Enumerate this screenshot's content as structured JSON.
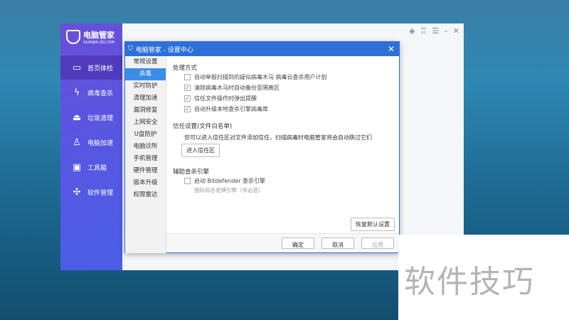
{
  "app": {
    "logo_title": "电脑管家",
    "logo_sub": "GUANJIA.QQ.COM",
    "nav": [
      {
        "label": "首页体检",
        "icon": "monitor-icon"
      },
      {
        "label": "病毒查杀",
        "icon": "lightning-icon"
      },
      {
        "label": "垃圾清理",
        "icon": "broom-icon"
      },
      {
        "label": "电脑加速",
        "icon": "rocket-icon"
      },
      {
        "label": "工具箱",
        "icon": "toolbox-icon"
      },
      {
        "label": "软件管理",
        "icon": "apps-icon"
      }
    ]
  },
  "dialog": {
    "title": "电脑管家 - 设置中心",
    "menu": [
      "常规设置",
      "杀毒",
      "实时防护",
      "清理加速",
      "漏洞修复",
      "上网安全",
      "U盘防护",
      "电脑诊所",
      "手机管理",
      "硬件管理",
      "版本升级",
      "权限雷达"
    ],
    "section1": "处理方式",
    "options": [
      {
        "label": "自动举报扫描到的疑似病毒木马  病毒云查杀用户计划",
        "checked": false
      },
      {
        "label": "清除病毒木马时自动备份至隔离区",
        "checked": true
      },
      {
        "label": "信任文件操作时弹出提醒",
        "checked": true
      },
      {
        "label": "自动升级本地查杀引擎病毒库",
        "checked": true
      }
    ],
    "section2": "信任设置(文件白名单)",
    "trust_desc": "您可以进入信任区对文件添加信任，扫描病毒时电脑管家将会自动跳过它们",
    "trust_button": "进入信任区",
    "section3": "辅助查杀引擎",
    "engine_option": {
      "label": "启动 Bitdefender 查杀引擎",
      "checked": false
    },
    "engine_note": "国际知名老牌引擎（非必选）",
    "restore_button": "恢复默认设置",
    "ok": "确定",
    "cancel": "取消",
    "apply": "应用"
  },
  "watermark": "软件技巧"
}
